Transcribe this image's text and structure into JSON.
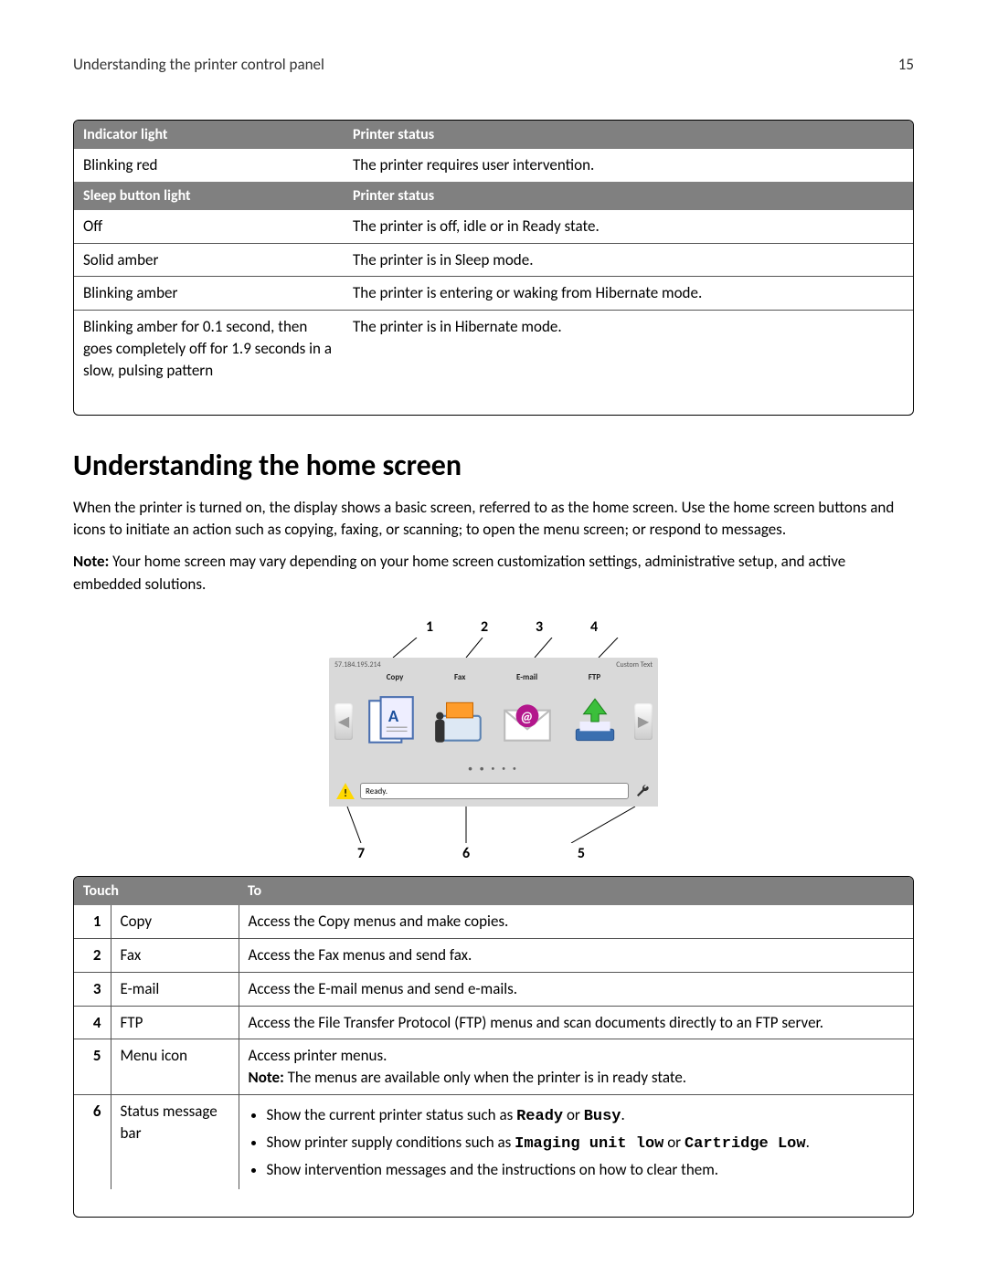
{
  "page_header": {
    "title": "Understanding the printer control panel",
    "page_number": "15"
  },
  "table1": {
    "header": {
      "c1": "Indicator light",
      "c2": "Printer status"
    },
    "rows": [
      {
        "c1": "Blinking red",
        "c2": "The printer requires user intervention."
      }
    ],
    "header2": {
      "c1": "Sleep button light",
      "c2": "Printer status"
    },
    "rows2": [
      {
        "c1": "Off",
        "c2": "The printer is off, idle or in Ready state."
      },
      {
        "c1": "Solid amber",
        "c2": "The printer is in Sleep mode."
      },
      {
        "c1": "Blinking amber",
        "c2": "The printer is entering or waking from Hibernate mode."
      },
      {
        "c1": "Blinking amber for 0.1 second, then goes completely off for 1.9 seconds in a slow, pulsing pattern",
        "c2": "The printer is in Hibernate mode."
      }
    ]
  },
  "heading": "Understanding the home screen",
  "para1": "When the printer is turned on, the display shows a basic screen, referred to as the home screen. Use the home screen buttons and icons to initiate an action such as copying, faxing, or scanning; to open the menu screen; or respond to messages.",
  "note_label": "Note:",
  "para2_rest": " Your home screen may vary depending on your home screen customization settings, administrative setup, and active embedded solutions.",
  "screen": {
    "ip": "57.184.195.214",
    "custom": "Custom Text",
    "labels": {
      "copy": "Copy",
      "fax": "Fax",
      "email": "E-mail",
      "ftp": "FTP"
    },
    "ready": "Ready.",
    "callouts_top": {
      "n1": "1",
      "n2": "2",
      "n3": "3",
      "n4": "4"
    },
    "callouts_bot": {
      "n7": "7",
      "n6": "6",
      "n5": "5"
    }
  },
  "table2": {
    "header": {
      "c1": "",
      "c2": "Touch",
      "c3": "To"
    },
    "rows": [
      {
        "n": "1",
        "t": "Copy",
        "d": "Access the Copy menus and make copies."
      },
      {
        "n": "2",
        "t": "Fax",
        "d": "Access the Fax menus and send fax."
      },
      {
        "n": "3",
        "t": "E-mail",
        "d": "Access the E-mail menus and send e-mails."
      },
      {
        "n": "4",
        "t": "FTP",
        "d": "Access the File Transfer Protocol (FTP) menus and scan documents directly to an FTP server."
      }
    ],
    "row5": {
      "n": "5",
      "t": "Menu icon",
      "d1": "Access printer menus.",
      "note_label": "Note:",
      "note_rest": " The menus are available only when the printer is in ready state."
    },
    "row6": {
      "n": "6",
      "t": "Status message bar",
      "b1_pre": "Show the current printer status such as ",
      "b1_m1": "Ready",
      "b1_mid": " or ",
      "b1_m2": "Busy",
      "b1_post": ".",
      "b2_pre": "Show printer supply conditions such as ",
      "b2_m1": "Imaging unit low",
      "b2_mid": " or ",
      "b2_m2": "Cartridge Low",
      "b2_post": ".",
      "b3": "Show intervention messages and the instructions on how to clear them."
    }
  }
}
